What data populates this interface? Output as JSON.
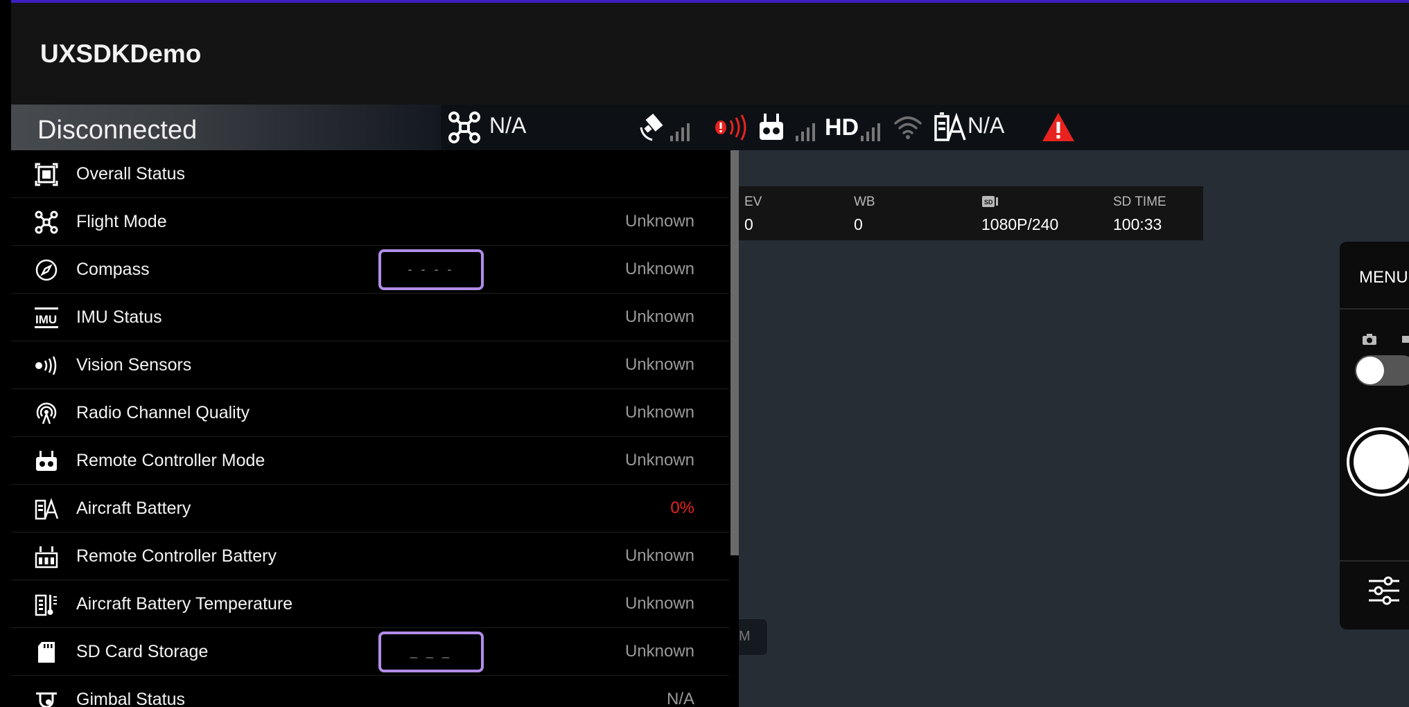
{
  "app": {
    "title": "UXSDKDemo"
  },
  "statusbar": {
    "connection": "Disconnected",
    "flight_mode_value": "N/A",
    "hd_label": "HD",
    "battery_value": "N/A",
    "icons": [
      "aircraft-icon",
      "gps-satellite-icon",
      "obstacle-avoidance-icon",
      "remote-controller-icon",
      "hd-video-signal-icon",
      "wifi-icon",
      "aircraft-battery-icon",
      "warning-icon"
    ],
    "colors": {
      "warning": "#e8231f",
      "accent": "#3d1fc4"
    }
  },
  "camera_info": [
    {
      "label": "EV",
      "value": "0"
    },
    {
      "label": "WB",
      "value": "0"
    },
    {
      "label": "SD",
      "value": "1080P/240"
    },
    {
      "label": "SD TIME",
      "value": "100:33"
    }
  ],
  "ghost_button": {
    "label": "M"
  },
  "right_panel": {
    "menu_label": "MENU"
  },
  "checklist": {
    "items": [
      {
        "label": "Overall Status",
        "value": "",
        "icon": "overall-status-icon"
      },
      {
        "label": "Flight Mode",
        "value": "Unknown",
        "icon": "drone-icon"
      },
      {
        "label": "Compass",
        "value": "Unknown",
        "icon": "compass-icon",
        "button": "- - - -"
      },
      {
        "label": "IMU Status",
        "value": "Unknown",
        "icon": "imu-icon"
      },
      {
        "label": "Vision Sensors",
        "value": "Unknown",
        "icon": "vision-sensor-icon"
      },
      {
        "label": "Radio Channel Quality",
        "value": "Unknown",
        "icon": "radio-signal-icon"
      },
      {
        "label": "Remote Controller Mode",
        "value": "Unknown",
        "icon": "remote-controller-icon"
      },
      {
        "label": "Aircraft Battery",
        "value": "0%",
        "icon": "aircraft-battery-icon"
      },
      {
        "label": "Remote Controller Battery",
        "value": "Unknown",
        "icon": "rc-battery-icon"
      },
      {
        "label": "Aircraft Battery Temperature",
        "value": "Unknown",
        "icon": "battery-temperature-icon"
      },
      {
        "label": "SD Card Storage",
        "value": "Unknown",
        "icon": "sd-card-icon",
        "button": "_ _ _"
      },
      {
        "label": "Gimbal Status",
        "value": "N/A",
        "icon": "gimbal-icon"
      }
    ]
  }
}
